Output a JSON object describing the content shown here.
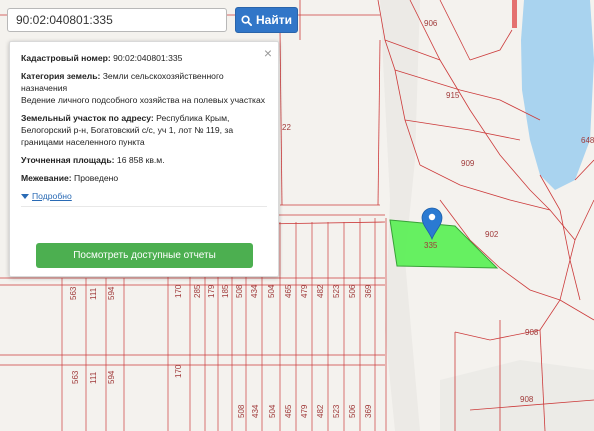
{
  "search": {
    "value": "90:02:040801:335",
    "button_label": "Найти"
  },
  "card": {
    "close_glyph": "×",
    "cadastral_label": "Кадастровый номер:",
    "cadastral_value": "90:02:040801:335",
    "category_label": "Категория земель:",
    "category_value": "Земли сельскохозяйственного назначения",
    "usage_value": "Ведение личного подсобного хозяйства на полевых участках",
    "address_label": "Земельный участок по адресу:",
    "address_value": "Республика Крым, Белогорский р-н, Богатовский с/с, уч 1, лот № 119, за границами населенного пункта",
    "area_label": "Уточненная площадь:",
    "area_value": "16 858 кв.м.",
    "survey_label": "Межевание:",
    "survey_value": "Проведено",
    "more_label": "Подробно",
    "report_button": "Посмотреть доступные отчеты"
  },
  "map": {
    "parcel_labels": [
      "906",
      "915",
      "909",
      "902",
      "908",
      "908",
      "648",
      "22",
      "335",
      "563",
      "111",
      "594",
      "563",
      "111",
      "594",
      "170",
      "170",
      "285",
      "179",
      "185",
      "508",
      "434",
      "504",
      "465",
      "479",
      "482",
      "523",
      "506",
      "369",
      "508",
      "434",
      "504",
      "465",
      "479",
      "482",
      "523",
      "506",
      "369"
    ],
    "colors": {
      "water": "#a9d3ef",
      "boundary": "#cc3b3b",
      "selected_parcel": "#5ff05a",
      "marker": "#2a7ad2",
      "background": "#f4f2ee"
    }
  }
}
